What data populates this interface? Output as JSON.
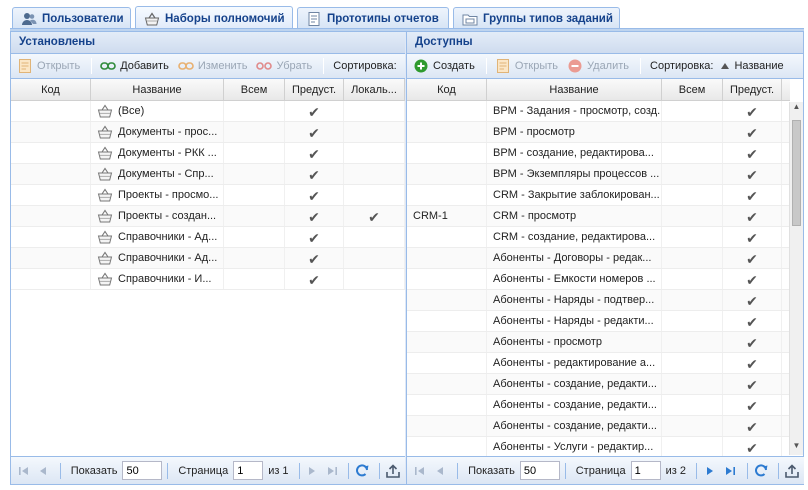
{
  "tabs": [
    {
      "label": "Пользователи",
      "icon": "users-icon",
      "active": false
    },
    {
      "label": "Наборы полномочий",
      "icon": "basket-icon",
      "active": true
    },
    {
      "label": "Прототипы отчетов",
      "icon": "report-icon",
      "active": false
    },
    {
      "label": "Группы типов заданий",
      "icon": "folder-icon",
      "active": false
    }
  ],
  "left": {
    "title": "Установлены",
    "toolbar": {
      "open": "Открыть",
      "add": "Добавить",
      "edit": "Изменить",
      "remove": "Убрать",
      "sort_label": "Сортировка:"
    },
    "columns": [
      "Код",
      "Название",
      "Всем",
      "Предуст.",
      "Локаль..."
    ],
    "rows": [
      {
        "code": "",
        "name": "(Все)",
        "all": false,
        "preset": true,
        "local": false
      },
      {
        "code": "",
        "name": "Документы - прос...",
        "all": false,
        "preset": true,
        "local": false
      },
      {
        "code": "",
        "name": "Документы - РКК ...",
        "all": false,
        "preset": true,
        "local": false
      },
      {
        "code": "",
        "name": "Документы - Спр...",
        "all": false,
        "preset": true,
        "local": false
      },
      {
        "code": "",
        "name": "Проекты - просмо...",
        "all": false,
        "preset": true,
        "local": false
      },
      {
        "code": "",
        "name": "Проекты - создан...",
        "all": false,
        "preset": true,
        "local": true
      },
      {
        "code": "",
        "name": "Справочники - Ад...",
        "all": false,
        "preset": true,
        "local": false
      },
      {
        "code": "",
        "name": "Справочники - Ад...",
        "all": false,
        "preset": true,
        "local": false
      },
      {
        "code": "",
        "name": "Справочники - И...",
        "all": false,
        "preset": true,
        "local": false
      }
    ],
    "pager": {
      "show_label": "Показать",
      "page_size": "50",
      "page_label": "Страница",
      "page": "1",
      "of_label": "из 1"
    }
  },
  "right": {
    "title": "Доступны",
    "toolbar": {
      "create": "Создать",
      "open": "Открыть",
      "delete": "Удалить",
      "sort_label": "Сортировка:",
      "sort_value": "Название"
    },
    "columns": [
      "Код",
      "Название",
      "Всем",
      "Предуст."
    ],
    "rows": [
      {
        "code": "",
        "name": "BPM - Задания - просмотр, созд...",
        "preset": true
      },
      {
        "code": "",
        "name": "BPM - просмотр",
        "preset": true
      },
      {
        "code": "",
        "name": "BPM - создание, редактирова...",
        "preset": true
      },
      {
        "code": "",
        "name": "BPM - Экземпляры процессов ...",
        "preset": true
      },
      {
        "code": "",
        "name": "CRM - Закрытие заблокирован...",
        "preset": true
      },
      {
        "code": "CRM-1",
        "name": "CRM - просмотр",
        "preset": true
      },
      {
        "code": "",
        "name": "CRM - создание, редактирова...",
        "preset": true
      },
      {
        "code": "",
        "name": "Абоненты - Договоры - редак...",
        "preset": true
      },
      {
        "code": "",
        "name": "Абоненты - Емкости номеров ...",
        "preset": true
      },
      {
        "code": "",
        "name": "Абоненты - Наряды - подтвер...",
        "preset": true
      },
      {
        "code": "",
        "name": "Абоненты - Наряды - редакти...",
        "preset": true
      },
      {
        "code": "",
        "name": "Абоненты - просмотр",
        "preset": true
      },
      {
        "code": "",
        "name": "Абоненты - редактирование а...",
        "preset": true
      },
      {
        "code": "",
        "name": "Абоненты - создание, редакти...",
        "preset": true
      },
      {
        "code": "",
        "name": "Абоненты - создание, редакти...",
        "preset": true
      },
      {
        "code": "",
        "name": "Абоненты - создание, редакти...",
        "preset": true
      },
      {
        "code": "",
        "name": "Абоненты - Услуги - редактир...",
        "preset": true
      }
    ],
    "pager": {
      "show_label": "Показать",
      "page_size": "50",
      "page_label": "Страница",
      "page": "1",
      "of_label": "из 2"
    }
  },
  "check_glyph": "✔",
  "colors": {
    "accent": "#15428b",
    "border": "#99bbe8",
    "create_green": "#2e9a2e",
    "delete_red": "#e05a4a"
  }
}
